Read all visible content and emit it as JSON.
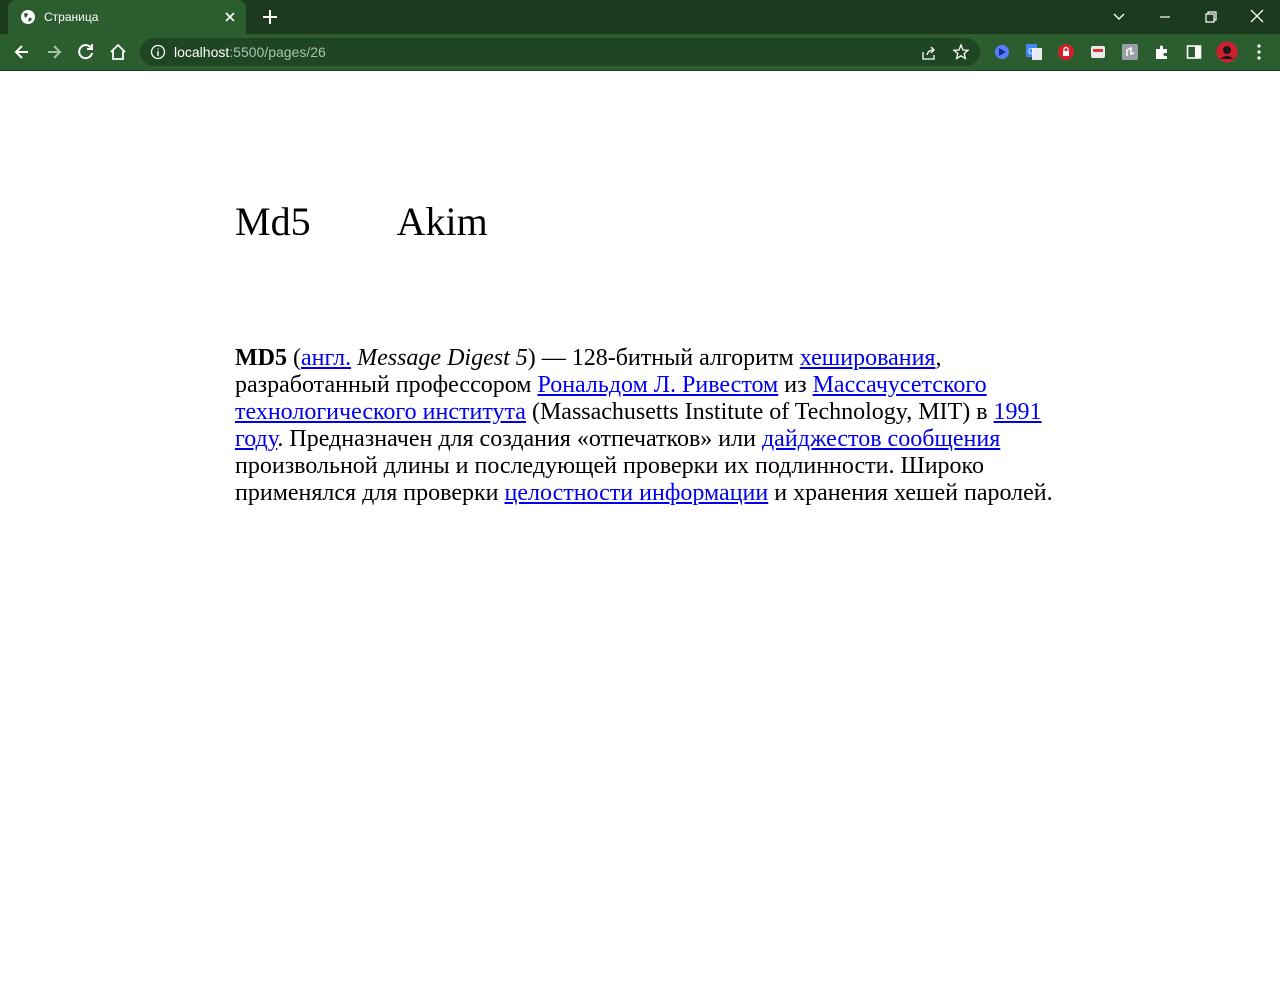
{
  "browser": {
    "tab": {
      "title": "Страница",
      "favicon": "globe-icon"
    },
    "address": {
      "host": "localhost",
      "rest": ":5500/pages/26"
    },
    "colors": {
      "frame": "#1b3a1e",
      "toolbar": "#2b5d2f",
      "omnibox": "#1f4623"
    }
  },
  "page": {
    "heading_left": "Md5",
    "heading_right": "Akim",
    "article": {
      "term": "MD5",
      "p1": " (",
      "link_lang": "англ.",
      "p2": " ",
      "italic": "Message Digest 5",
      "p3": ") — 128-битный алгоритм ",
      "link_hashing": "хеширования",
      "p4": ", разработанный профессором ",
      "link_rivest": "Рональдом Л. Ривестом",
      "p5": " из ",
      "link_mit": "Массачусетского технологического института",
      "p6": " (Massachusetts Institute of Technology, MIT) в ",
      "link_year": "1991 году",
      "p7": ". Предназначен для создания «отпечатков» или ",
      "link_digest": "дайджестов сообщения",
      "p8": " произвольной длины и последующей проверки их подлинности. Широко применялся для проверки ",
      "link_integrity": "целостности информации",
      "p9": " и хранения хешей паролей."
    }
  }
}
